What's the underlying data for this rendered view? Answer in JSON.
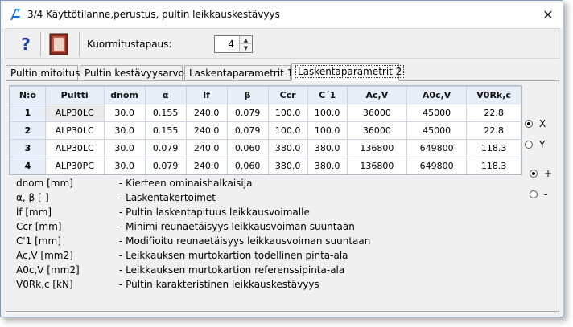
{
  "window": {
    "title": "3/4  Käyttötilanne,perustus, pultin leikkauskestävyys",
    "close_glyph": "✕"
  },
  "toolbar": {
    "help_glyph": "?",
    "kuormitus_label": "Kuormitustapaus:",
    "kuormitus_value": "4",
    "spin_up_glyph": "▲",
    "spin_down_glyph": "▼"
  },
  "tabs": [
    {
      "label": "Pultin mitoitus",
      "active": false
    },
    {
      "label": "Pultin kestävyysarvot",
      "active": false
    },
    {
      "label": "Laskentaparametrit 1",
      "active": false
    },
    {
      "label": "Laskentaparametrit 2",
      "active": true
    }
  ],
  "table": {
    "headers": [
      "N:o",
      "Pultti",
      "dnom",
      "α",
      "lf",
      "β",
      "Ccr",
      "C´1",
      "Ac,V",
      "A0c,V",
      "V0Rk,c"
    ],
    "rows": [
      [
        "1",
        "ALP30LC",
        "30.0",
        "0.155",
        "240.0",
        "0.079",
        "100.0",
        "100.0",
        "36000",
        "45000",
        "22.8"
      ],
      [
        "2",
        "ALP30LC",
        "30.0",
        "0.155",
        "240.0",
        "0.079",
        "100.0",
        "100.0",
        "36000",
        "45000",
        "22.8"
      ],
      [
        "3",
        "ALP30LC",
        "30.0",
        "0.079",
        "240.0",
        "0.060",
        "380.0",
        "380.0",
        "136800",
        "649800",
        "118.3"
      ],
      [
        "4",
        "ALP30PC",
        "30.0",
        "0.079",
        "240.0",
        "0.060",
        "380.0",
        "380.0",
        "136800",
        "649800",
        "118.3"
      ]
    ]
  },
  "axis_radios": [
    {
      "label": "X",
      "checked": true
    },
    {
      "label": "Y",
      "checked": false
    }
  ],
  "sign_radios": [
    {
      "label": "+",
      "checked": true
    },
    {
      "label": "-",
      "checked": false
    }
  ],
  "legend": [
    {
      "term": "dnom [mm]",
      "desc": "- Kierteen ominaishalkaisija"
    },
    {
      "term": "α, β  [-]",
      "desc": "- Laskentakertoimet"
    },
    {
      "term": "lf [mm]",
      "desc": "- Pultin laskentapituus leikkausvoimalle"
    },
    {
      "term": "Ccr [mm]",
      "desc": "- Minimi reunaetäisyys leikkausvoiman suuntaan"
    },
    {
      "term": "C'1 [mm]",
      "desc": "- Modifioitu reunaetäisyys leikkausvoiman suuntaan"
    },
    {
      "term": "Ac,V [mm2]",
      "desc": "- Leikkauksen murtokartion todellinen pinta-ala"
    },
    {
      "term": "A0c,V [mm2]",
      "desc": "- Leikkauksen murtokartion referenssipinta-ala"
    },
    {
      "term": "V0Rk,c [kN]",
      "desc": "- Pultin karakteristinen leikkauskestävyys"
    }
  ]
}
